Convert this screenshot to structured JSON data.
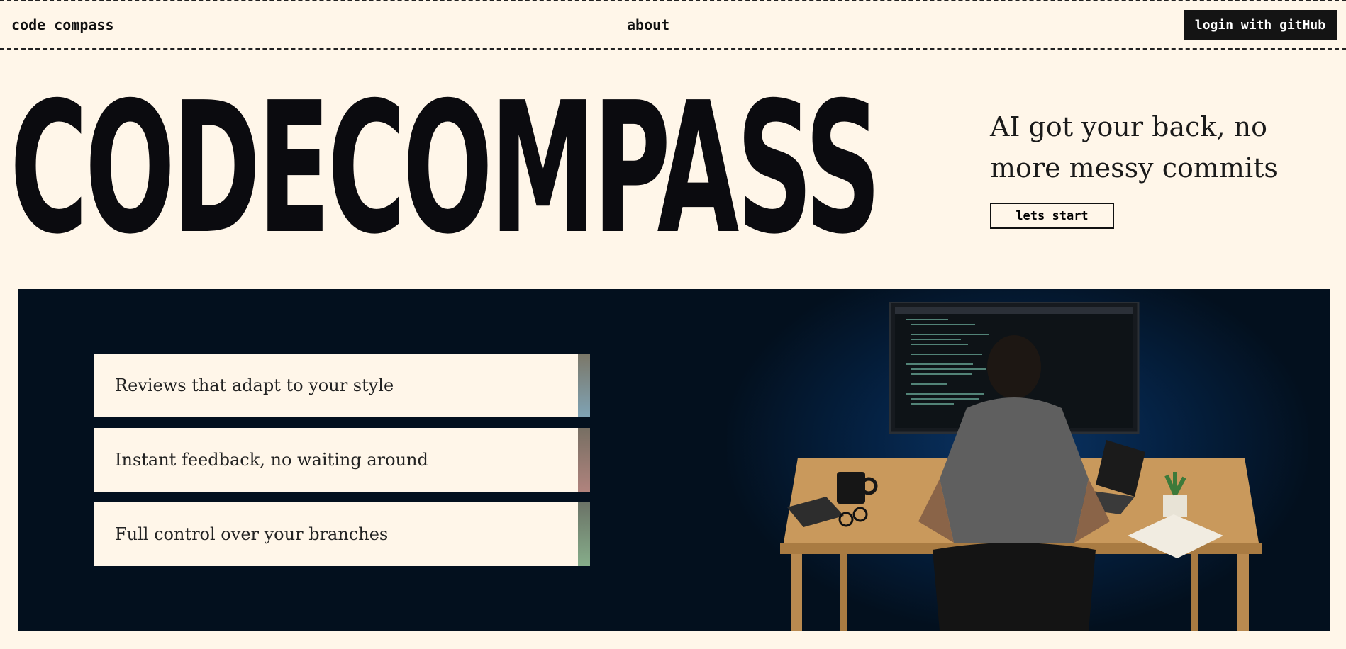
{
  "nav": {
    "brand": "code compass",
    "about": "about",
    "login": "login with gitHub"
  },
  "hero": {
    "title": "CODECOMPASS",
    "tagline": "AI got your back, no more messy commits",
    "cta": "lets start"
  },
  "features": [
    {
      "label": "Reviews that adapt to your style",
      "accent_from": "#7b7768",
      "accent_to": "#7fa3b5"
    },
    {
      "label": "Instant feedback, no waiting around",
      "accent_from": "#776f63",
      "accent_to": "#b0837d"
    },
    {
      "label": "Full control over your branches",
      "accent_from": "#6b7367",
      "accent_to": "#86ad8a"
    }
  ],
  "colors": {
    "background": "#fff6e9",
    "banner": "#03101e",
    "button_dark": "#141414",
    "text": "#111111"
  }
}
